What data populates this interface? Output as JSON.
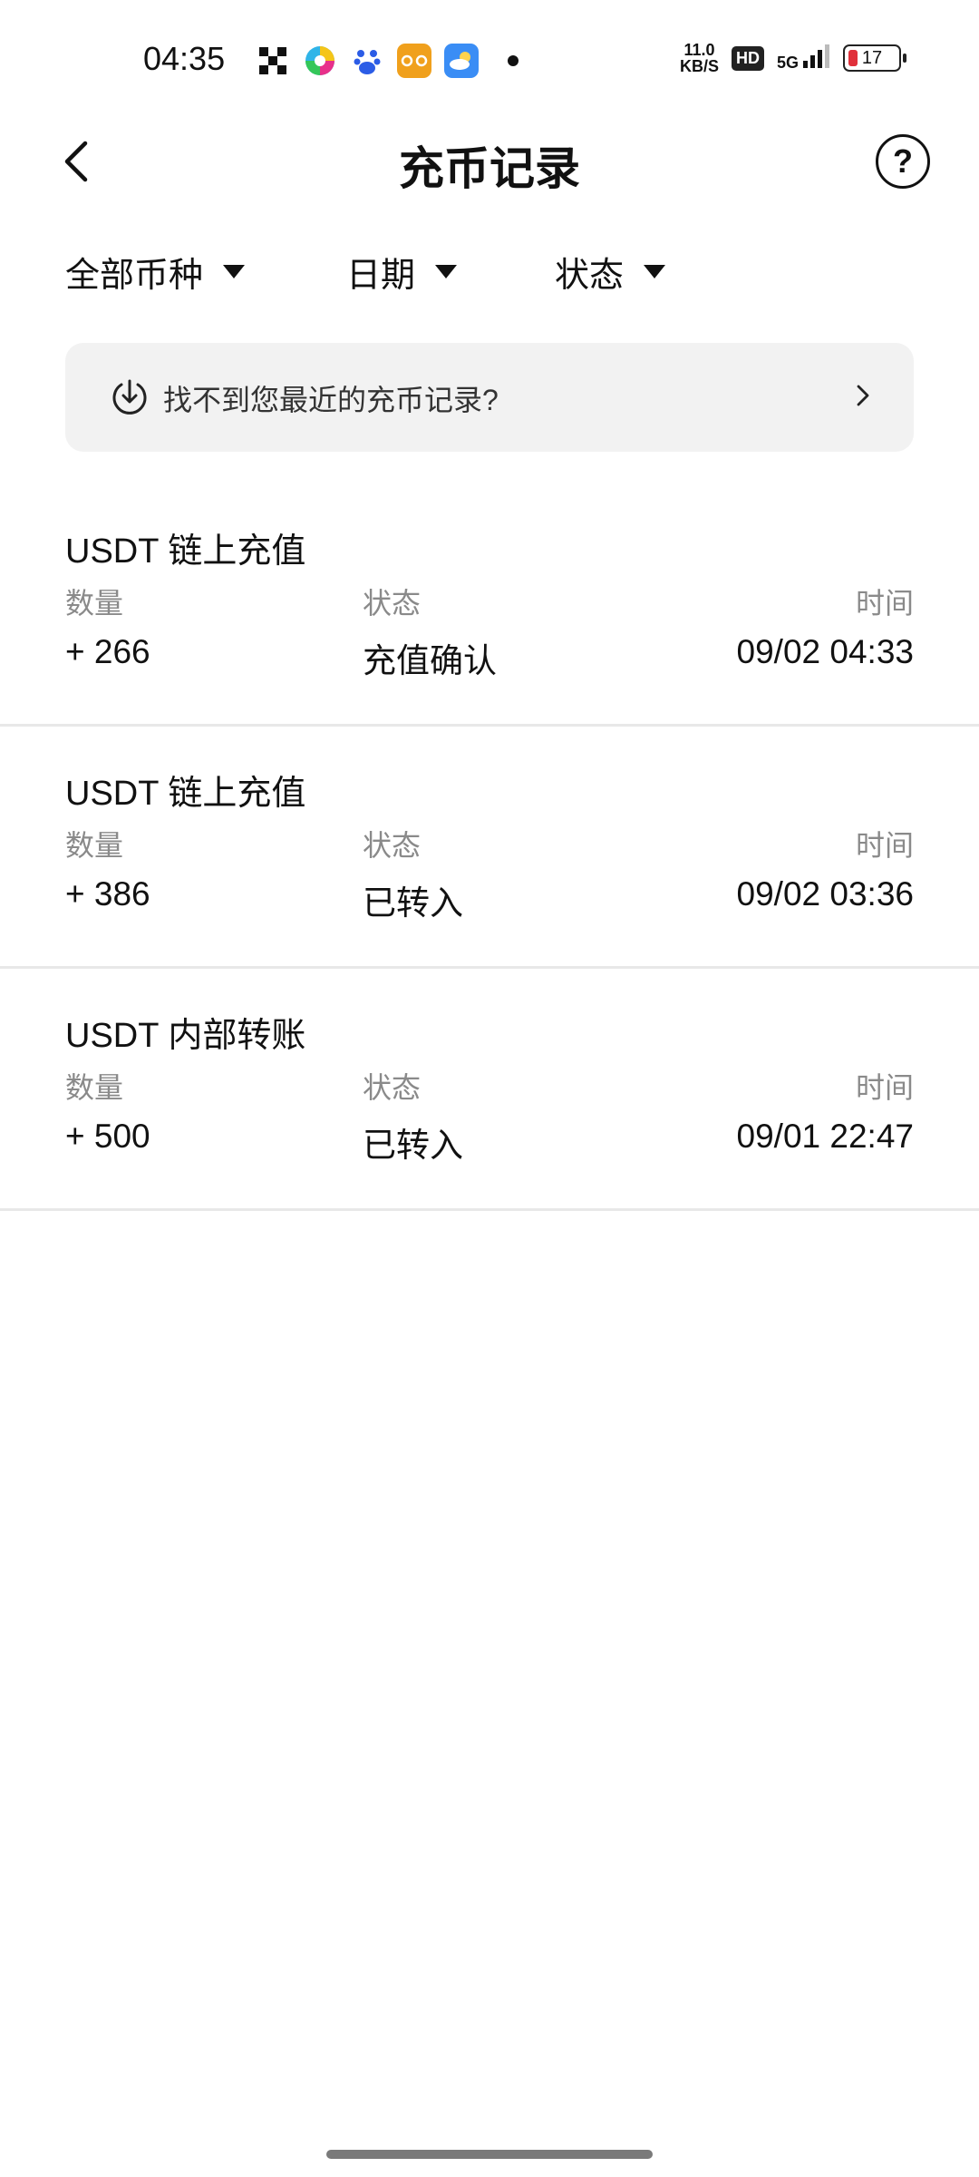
{
  "status_bar": {
    "time": "04:35",
    "net_speed_value": "11.0",
    "net_speed_unit": "KB/S",
    "hd_label": "HD",
    "signal_label": "5G",
    "battery_level": "17",
    "app_icons": [
      "qr-app-icon",
      "pinwheel-app-icon",
      "baidu-app-icon",
      "imou-app-icon",
      "weather-app-icon"
    ]
  },
  "header": {
    "title": "充币记录",
    "help_label": "?"
  },
  "filters": [
    {
      "label": "全部币种"
    },
    {
      "label": "日期"
    },
    {
      "label": "状态"
    }
  ],
  "banner": {
    "text": "找不到您最近的充币记录?"
  },
  "column_labels": {
    "amount": "数量",
    "status": "状态",
    "time": "时间"
  },
  "records": [
    {
      "title": "USDT 链上充值",
      "amount": "+ 266",
      "status": "充值确认",
      "time": "09/02 04:33"
    },
    {
      "title": "USDT 链上充值",
      "amount": "+ 386",
      "status": "已转入",
      "time": "09/02 03:36"
    },
    {
      "title": "USDT 内部转账",
      "amount": "+ 500",
      "status": "已转入",
      "time": "09/01 22:47"
    }
  ]
}
